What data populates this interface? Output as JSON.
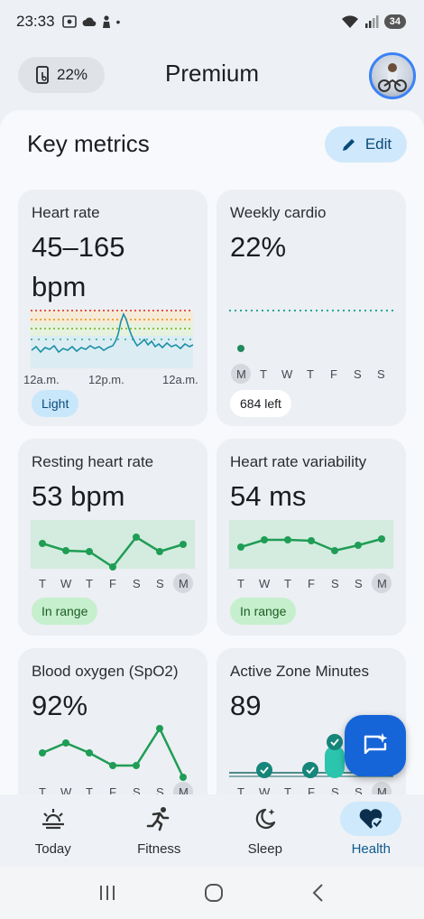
{
  "status_bar": {
    "time": "23:33",
    "battery": "34"
  },
  "header": {
    "battery_chip": "22%",
    "title": "Premium"
  },
  "section": {
    "title": "Key metrics",
    "edit_label": "Edit"
  },
  "colors": {
    "accent_blue": "#1565d8",
    "teal_line": "#1a8fa8",
    "green_point": "#1f9d55",
    "range_band": "#d3ecdf"
  },
  "cards": {
    "heart_rate": {
      "title": "Heart rate",
      "value_line1": "45–165",
      "value_line2": "bpm",
      "x_labels": [
        "12a.m.",
        "12p.m.",
        "12a.m."
      ],
      "badge": "Light"
    },
    "weekly_cardio": {
      "title": "Weekly cardio",
      "value": "22%",
      "days": [
        "M",
        "T",
        "W",
        "T",
        "F",
        "S",
        "S"
      ],
      "badge": "684 left"
    },
    "resting_hr": {
      "title": "Resting heart rate",
      "value": "53 bpm",
      "days": [
        "T",
        "W",
        "T",
        "F",
        "S",
        "S",
        "M"
      ],
      "badge": "In range"
    },
    "hrv": {
      "title": "Heart rate variability",
      "value": "54 ms",
      "days": [
        "T",
        "W",
        "T",
        "F",
        "S",
        "S",
        "M"
      ],
      "badge": "In range"
    },
    "spo2": {
      "title": "Blood oxygen (SpO2)",
      "value": "92%",
      "days": [
        "T",
        "W",
        "T",
        "F",
        "S",
        "S",
        "M"
      ]
    },
    "azm": {
      "title": "Active Zone Minutes",
      "value": "89",
      "days": [
        "T",
        "W",
        "T",
        "F",
        "S",
        "S",
        "M"
      ]
    }
  },
  "bottom_nav": [
    {
      "label": "Today",
      "icon": "sunrise-icon"
    },
    {
      "label": "Fitness",
      "icon": "running-icon"
    },
    {
      "label": "Sleep",
      "icon": "moon-stars-icon"
    },
    {
      "label": "Health",
      "icon": "heart-check-icon"
    }
  ]
}
